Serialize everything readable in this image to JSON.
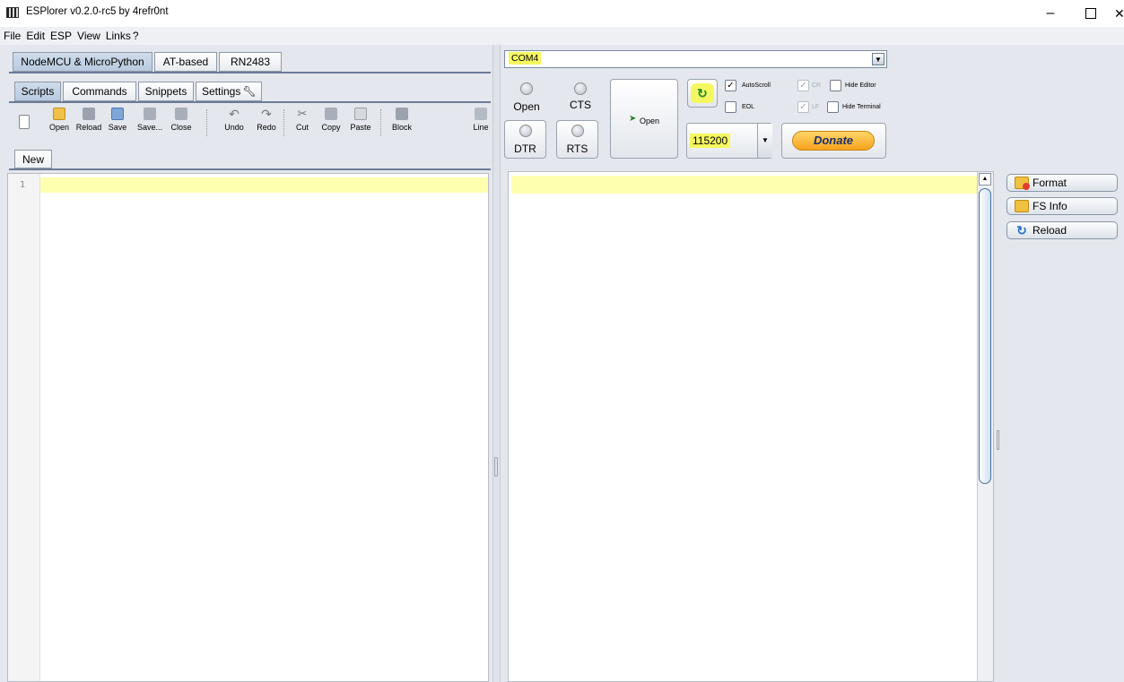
{
  "window": {
    "title": "ESPlorer v0.2.0-rc5 by 4refr0nt",
    "minimize": "–",
    "close": "✕"
  },
  "menu": [
    "File",
    "Edit",
    "ESP",
    "View",
    "Links",
    "?"
  ],
  "device_tabs": [
    "NodeMCU & MicroPython",
    "AT-based",
    "RN2483"
  ],
  "script_tabs": [
    "Scripts",
    "Commands",
    "Snippets",
    "Settings"
  ],
  "toolbar": {
    "open": "Open",
    "reload": "Reload",
    "save": "Save",
    "save_as": "Save...",
    "close": "Close",
    "undo": "Undo",
    "redo": "Redo",
    "cut": "Cut",
    "copy": "Copy",
    "paste": "Paste",
    "block": "Block",
    "line": "Line"
  },
  "file_tab": "New",
  "editor": {
    "line_number": "1"
  },
  "connection": {
    "port": "COM4",
    "open_led": "Open",
    "cts_led": "CTS",
    "dtr": "DTR",
    "rts": "RTS",
    "open_button": "Open",
    "baud": "115200",
    "donate": "Donate",
    "autoscroll": "AutoScroll",
    "eol": "EOL",
    "cr": "CR",
    "lf": "LF",
    "hide_editor": "Hide Editor",
    "hide_terminal": "Hide Terminal"
  },
  "side_buttons": {
    "format": "Format",
    "fs_info": "FS Info",
    "reload": "Reload"
  },
  "colors": {
    "highlight": "#f4f760",
    "current_line": "#ffffb0",
    "donate": "#f7a21b"
  }
}
